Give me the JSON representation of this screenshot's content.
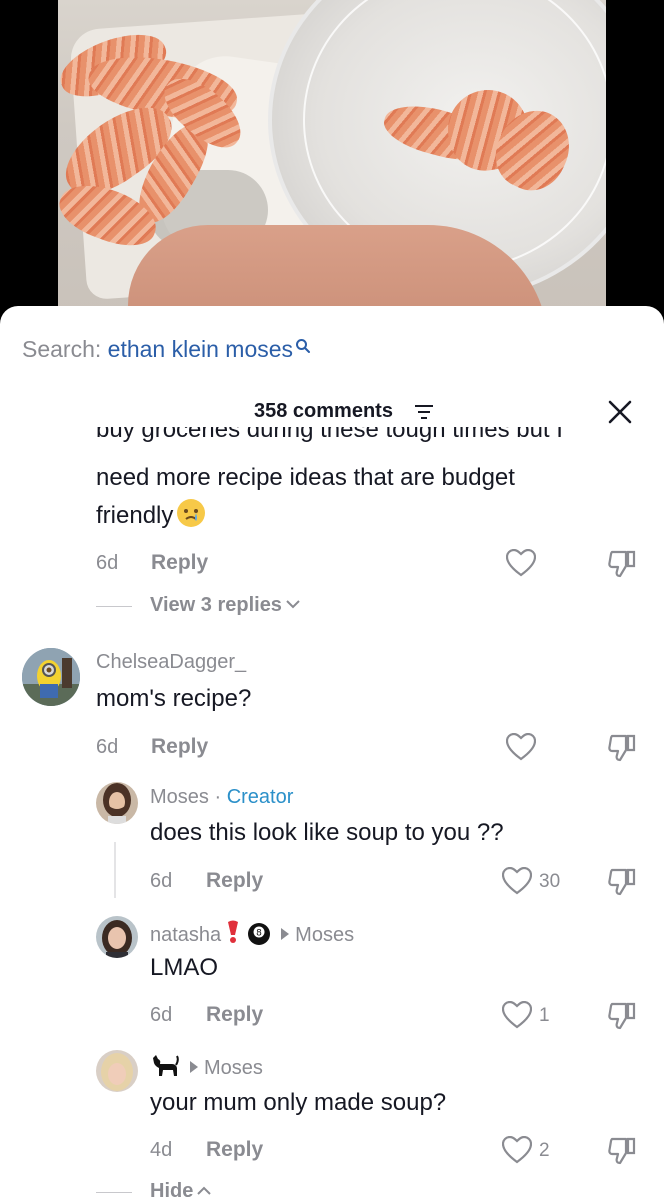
{
  "search": {
    "prefix": "Search: ",
    "term": "ethan klein moses"
  },
  "header": {
    "count": "358 comments"
  },
  "clipped_line": "buy groceries during these tough times but I",
  "comment1": {
    "line2": "need more recipe ideas that are budget",
    "line3": "friendly",
    "time": "6d",
    "reply": "Reply",
    "view_replies": "View 3 replies"
  },
  "comment2": {
    "user": "ChelseaDagger_",
    "text": "mom's recipe?",
    "time": "6d",
    "reply": "Reply"
  },
  "reply1": {
    "user": "Moses",
    "sep": " · ",
    "badge": "Creator",
    "text": "does this look like soup to you ??",
    "time": "6d",
    "reply": "Reply",
    "likes": "30"
  },
  "reply2": {
    "user": "natasha",
    "to": "Moses",
    "text": "LMAO",
    "time": "6d",
    "reply": "Reply",
    "likes": "1"
  },
  "reply3": {
    "to": "Moses",
    "text": "your mum only made soup?",
    "time": "4d",
    "reply": "Reply",
    "likes": "2"
  },
  "hide": "Hide",
  "icons": [
    "search-icon",
    "sort-icon",
    "close-icon",
    "heart-icon",
    "dislike-icon",
    "chevron-down-icon",
    "chevron-up-icon"
  ],
  "colors": {
    "link": "#2b5ea8",
    "creator": "#2b90c9",
    "muted": "#8a8b91",
    "text": "#161823"
  }
}
